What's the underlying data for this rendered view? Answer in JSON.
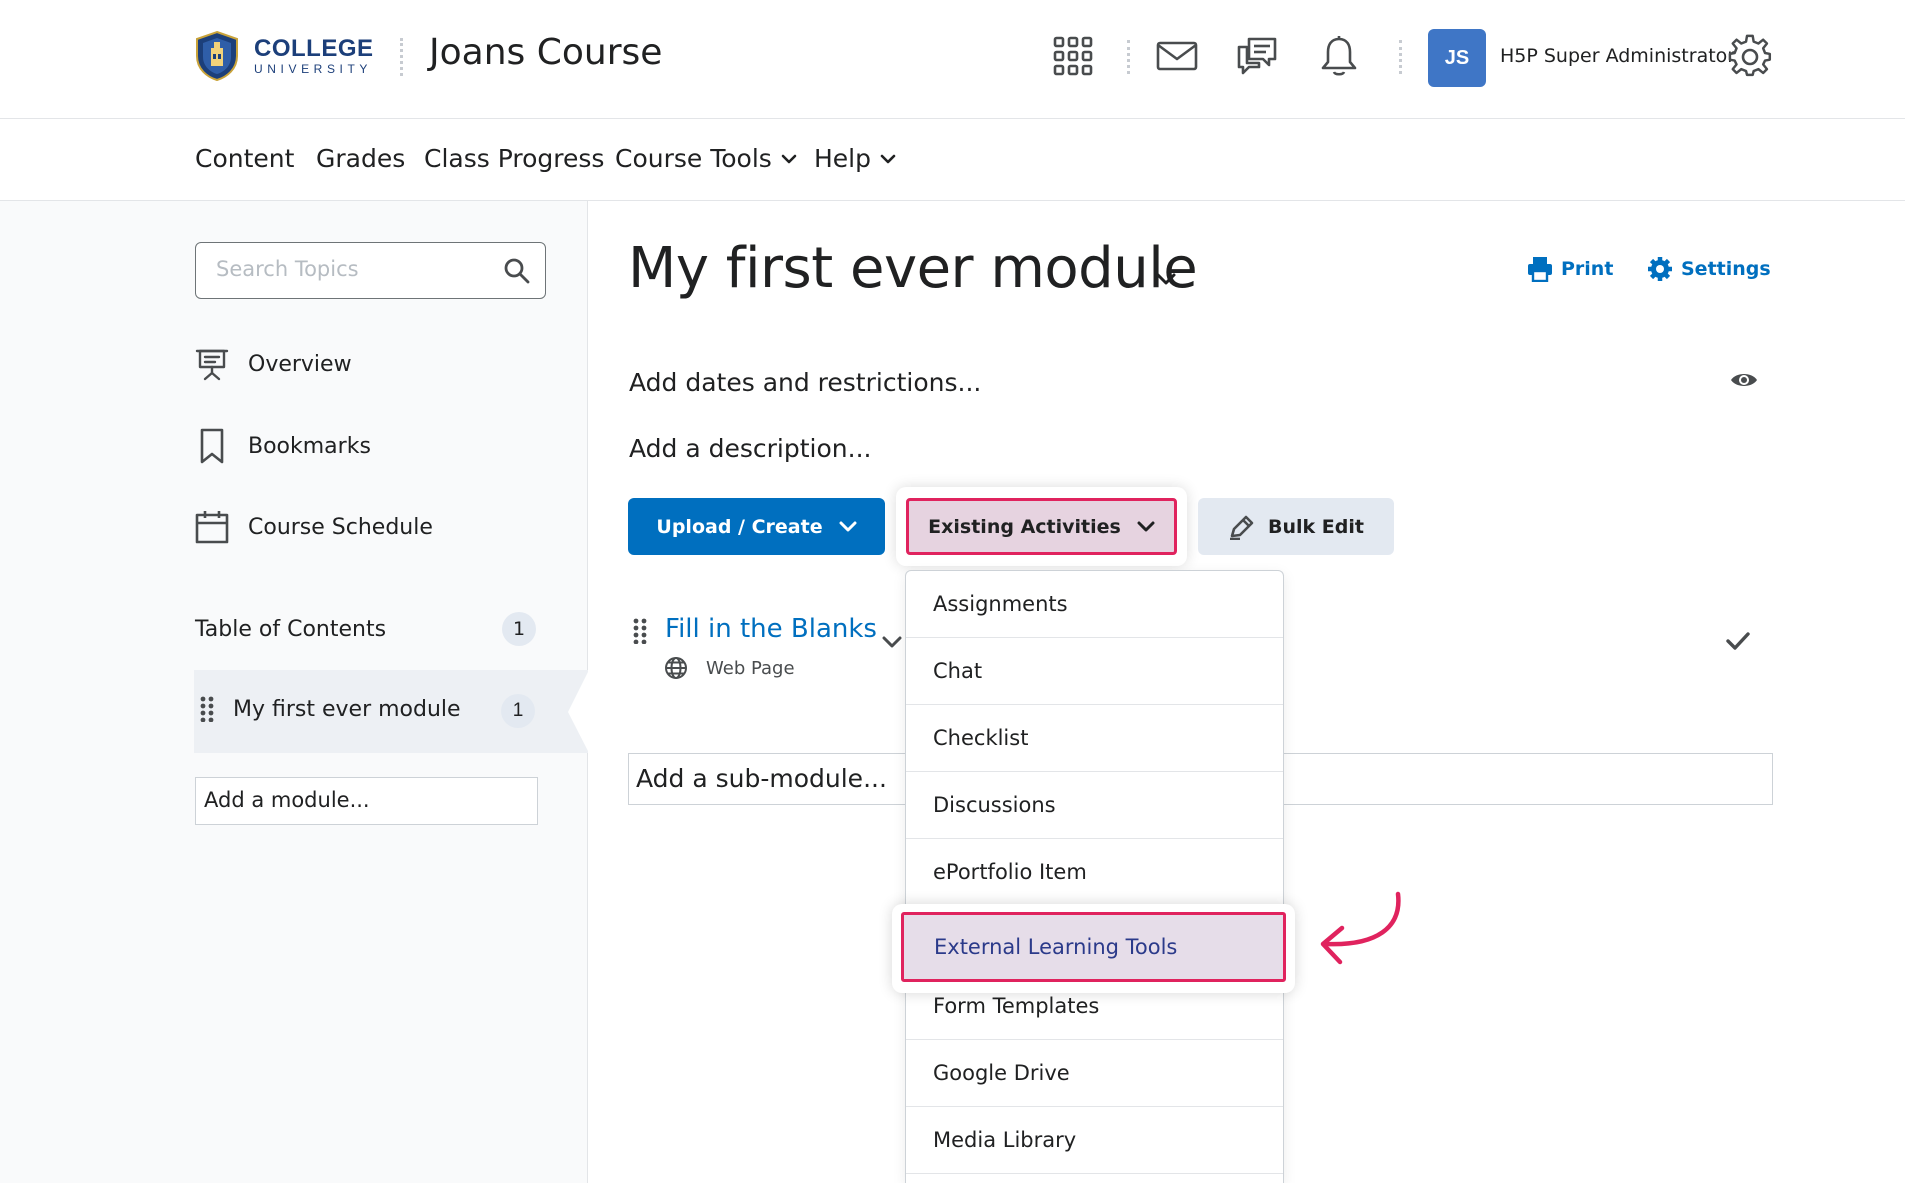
{
  "header": {
    "logo": {
      "line1": "COLLEGE",
      "line2": "UNIVERSITY"
    },
    "course_title": "Joans Course",
    "icons": [
      "apps-grid-icon",
      "mail-icon",
      "chat-icon",
      "bell-icon",
      "settings-gear-icon"
    ],
    "avatar_initials": "JS",
    "user_name": "H5P Super Administrator"
  },
  "nav": {
    "items": [
      {
        "label": "Content"
      },
      {
        "label": "Grades"
      },
      {
        "label": "Class Progress"
      },
      {
        "label": "Course Tools"
      },
      {
        "label": "Help"
      }
    ]
  },
  "sidebar": {
    "search_placeholder": "Search Topics",
    "links": [
      {
        "label": "Overview",
        "icon": "presentation-board-icon"
      },
      {
        "label": "Bookmarks",
        "icon": "bookmark-icon"
      },
      {
        "label": "Course Schedule",
        "icon": "calendar-icon"
      }
    ],
    "toc": {
      "label": "Table of Contents",
      "count": "1"
    },
    "module": {
      "label": "My first ever module",
      "count": "1"
    },
    "add_module_placeholder": "Add a module..."
  },
  "main": {
    "title": "My first ever module",
    "print_label": "Print",
    "settings_label": "Settings",
    "dates_text": "Add dates and restrictions...",
    "description_text": "Add a description...",
    "buttons": {
      "upload_create": "Upload / Create",
      "existing_activities": "Existing Activities",
      "bulk_edit": "Bulk Edit"
    },
    "item": {
      "title": "Fill in the Blanks",
      "type": "Web Page"
    },
    "submodule_placeholder": "Add a sub-module..."
  },
  "dropdown": {
    "items": [
      {
        "label": "Assignments"
      },
      {
        "label": "Chat"
      },
      {
        "label": "Checklist"
      },
      {
        "label": "Discussions"
      },
      {
        "label": "ePortfolio Item"
      },
      {
        "label": "External Learning Tools",
        "highlighted": true
      },
      {
        "label": "Form Templates"
      },
      {
        "label": "Google Drive"
      },
      {
        "label": "Media Library"
      }
    ]
  },
  "colors": {
    "primary": "#006fbf",
    "highlight_border": "#e0235e",
    "highlight_fill": "#e6d3e0",
    "brand_navy": "#1c3f7a"
  }
}
